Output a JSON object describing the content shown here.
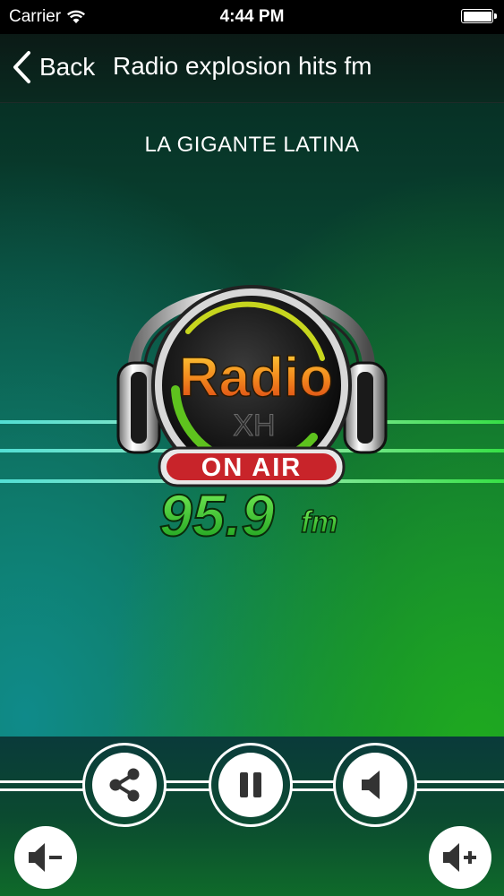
{
  "status_bar": {
    "carrier": "Carrier",
    "time": "4:44 PM"
  },
  "nav": {
    "back_label": "Back",
    "title": "Radio explosion hits fm"
  },
  "station": {
    "slogan": "LA GIGANTE LATINA",
    "logo_radio": "Radio",
    "logo_callsign": "XH",
    "logo_on_air": "ON AIR",
    "logo_frequency": "95.9",
    "logo_band": "fm"
  },
  "controls": {
    "share_icon": "share-icon",
    "pause_icon": "pause-icon",
    "speaker_icon": "speaker-icon",
    "volume_down_icon": "volume-down-icon",
    "volume_up_icon": "volume-up-icon"
  },
  "colors": {
    "accent_green": "#22c31e",
    "accent_cyan": "#28e0d0",
    "on_air_red": "#c8242a",
    "radio_orange": "#f2a21e"
  }
}
